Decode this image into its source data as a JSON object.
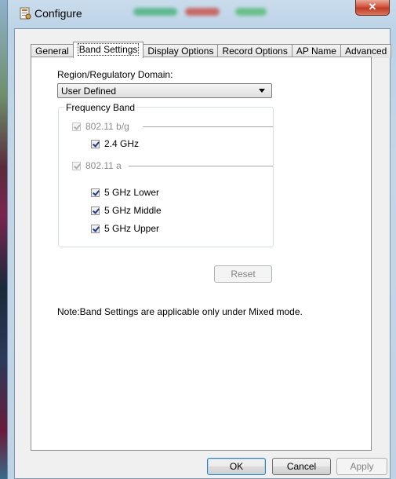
{
  "window": {
    "title": "Configure",
    "close_glyph": "✕",
    "icon": "configure-app-icon"
  },
  "tabs": [
    {
      "label": "General",
      "active": false
    },
    {
      "label": "Band Settings",
      "active": true
    },
    {
      "label": "Display Options",
      "active": false
    },
    {
      "label": "Record Options",
      "active": false
    },
    {
      "label": "AP Name",
      "active": false
    },
    {
      "label": "Advanced",
      "active": false
    }
  ],
  "band_settings": {
    "region_label": "Region/Regulatory Domain:",
    "region_value": "User Defined",
    "frequency_group_label": "Frequency Band",
    "bands": {
      "bg": {
        "label": "802.11 b/g",
        "checked": true,
        "enabled": false
      },
      "ghz24": {
        "label": "2.4 GHz",
        "checked": true,
        "enabled": true
      },
      "a": {
        "label": "802.11 a",
        "checked": true,
        "enabled": false
      },
      "ghz5_lower": {
        "label": "5 GHz Lower",
        "checked": true,
        "enabled": true
      },
      "ghz5_middle": {
        "label": "5 GHz Middle",
        "checked": true,
        "enabled": true
      },
      "ghz5_upper": {
        "label": "5 GHz Upper",
        "checked": true,
        "enabled": true
      }
    },
    "reset_label": "Reset",
    "note": "Note:Band Settings are applicable only under Mixed mode."
  },
  "footer": {
    "ok_label": "OK",
    "cancel_label": "Cancel",
    "apply_label": "Apply"
  },
  "colors": {
    "accent": "#3c7fb1",
    "close": "#c23a25"
  }
}
